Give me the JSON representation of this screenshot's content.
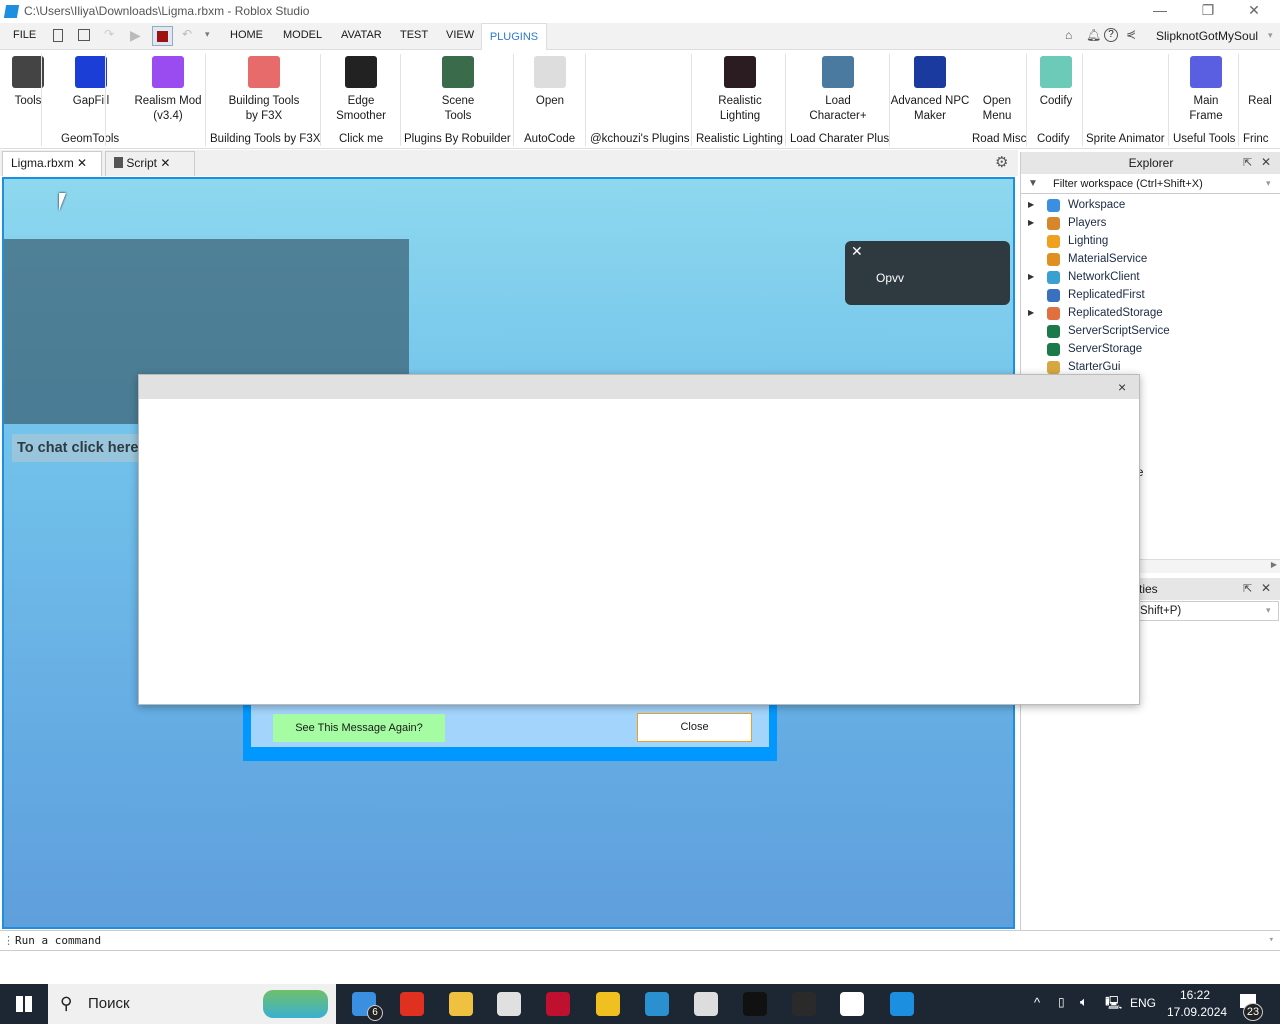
{
  "window": {
    "title": "C:\\Users\\Iliya\\Downloads\\Ligma.rbxm - Roblox Studio",
    "minimize": "—",
    "restore": "❐",
    "close": "✕"
  },
  "menu": {
    "file": "FILE",
    "tabs": [
      "HOME",
      "MODEL",
      "AVATAR",
      "TEST",
      "VIEW",
      "PLUGINS"
    ],
    "active": "PLUGINS",
    "user": "SlipknotGotMySoul"
  },
  "ribbon": {
    "buttons": [
      {
        "label": "Tools",
        "color": "#444"
      },
      {
        "label": "GapFill",
        "color": "#1b3fd6"
      },
      {
        "label": "Realism Mod\n(v3.4)",
        "color": "#9a4cf0"
      },
      {
        "label": "Building Tools\nby F3X",
        "color": "#e86b6b"
      },
      {
        "label": "Edge\nSmoother",
        "color": "#222"
      },
      {
        "label": "Scene\nTools",
        "color": "#3a6b4a"
      },
      {
        "label": "Open",
        "color": "#ddd"
      },
      {
        "label": "Realistic\nLighting",
        "color": "#2a1c20"
      },
      {
        "label": "Load\nCharacter+",
        "color": "#4a7aa0"
      },
      {
        "label": "Advanced NPC\nMaker",
        "color": "#1a3aa0"
      },
      {
        "label": "Open\nMenu",
        "color": ""
      },
      {
        "label": "Codify",
        "color": "#6ccab8"
      },
      {
        "label": "Main\nFrame",
        "color": "#5a5ee0"
      },
      {
        "label": "Real",
        "color": ""
      }
    ],
    "groups": [
      "GeomTools",
      "Building Tools by F3X",
      "Click me",
      "Plugins By Robuilder",
      "AutoCode",
      "@kchouzi's Plugins",
      "Realistic Lighting",
      "Load Charater Plus",
      "Road Misc",
      "Codify",
      "Sprite Animator",
      "Useful Tools",
      "Frinc"
    ]
  },
  "doc_tabs": [
    {
      "label": "Ligma.rbxm"
    },
    {
      "label": "Script"
    }
  ],
  "viewport": {
    "chat_hint": "To chat click here or press \"/\" key",
    "notification": "Opvv",
    "see_again": "See This Message Again?",
    "close": "Close"
  },
  "dialog": {
    "close": "×"
  },
  "explorer": {
    "title": "Explorer",
    "filter": "Filter workspace (Ctrl+Shift+X)",
    "items": [
      {
        "label": "Workspace",
        "expand": true,
        "color": "#3a8fe0"
      },
      {
        "label": "Players",
        "expand": true,
        "color": "#d8862a"
      },
      {
        "label": "Lighting",
        "expand": false,
        "color": "#f0a020"
      },
      {
        "label": "MaterialService",
        "expand": false,
        "color": "#e09020"
      },
      {
        "label": "NetworkClient",
        "expand": true,
        "color": "#3aa0d0"
      },
      {
        "label": "ReplicatedFirst",
        "expand": false,
        "color": "#3a70c0"
      },
      {
        "label": "ReplicatedStorage",
        "expand": true,
        "color": "#e07040"
      },
      {
        "label": "ServerScriptService",
        "expand": false,
        "color": "#1a7a4a"
      },
      {
        "label": "ServerStorage",
        "expand": false,
        "color": "#1a7a4a"
      },
      {
        "label": "StarterGui",
        "expand": false,
        "color": "#d8a840"
      }
    ],
    "partial_text": "e"
  },
  "properties": {
    "title_partial": "ties",
    "filter_partial": "Shift+P)"
  },
  "command": {
    "placeholder": "Run a command"
  },
  "taskbar": {
    "search": "Поиск",
    "mail_badge": "6",
    "lang": "ENG",
    "time": "16:22",
    "date": "17.09.2024",
    "notif_count": "23"
  }
}
